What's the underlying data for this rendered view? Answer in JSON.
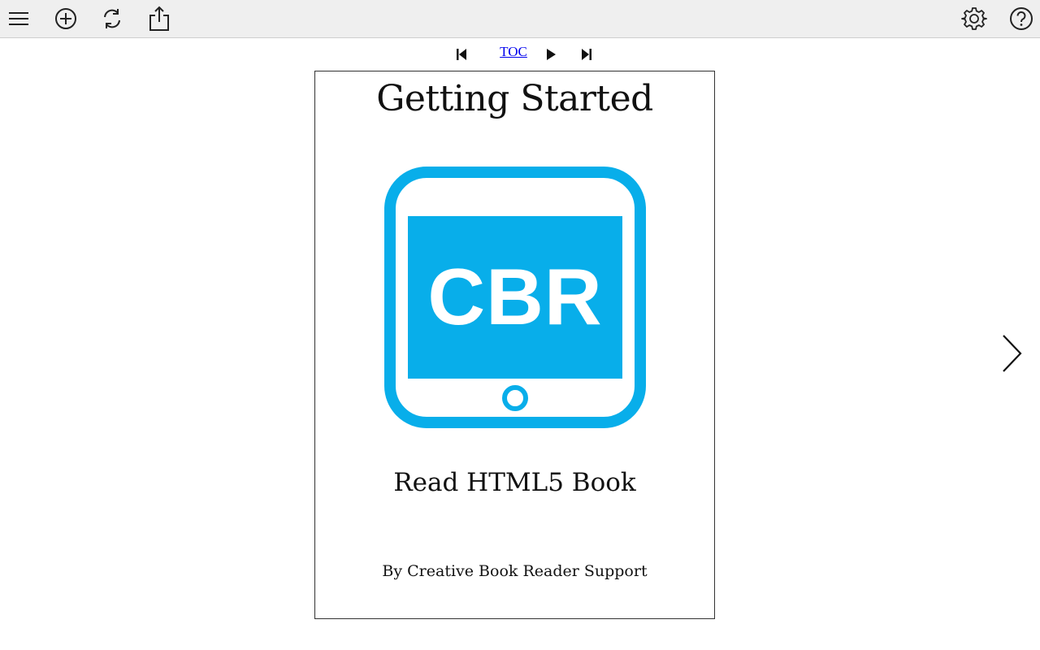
{
  "toolbar": {
    "left_icons": [
      "menu-icon",
      "add-icon",
      "refresh-icon",
      "share-icon"
    ],
    "right_icons": [
      "gear-icon",
      "help-icon"
    ],
    "background": "#efefef"
  },
  "navigation": {
    "toc_label": "TOC",
    "icons": [
      "first-page-icon",
      "play-icon",
      "last-page-icon",
      "next-page-chevron-icon"
    ]
  },
  "book_page": {
    "title": "Getting Started",
    "logo_text": "CBR",
    "logo_color": "#08aeea",
    "subtitle": "Read HTML5 Book",
    "author": "By Creative Book Reader Support"
  }
}
